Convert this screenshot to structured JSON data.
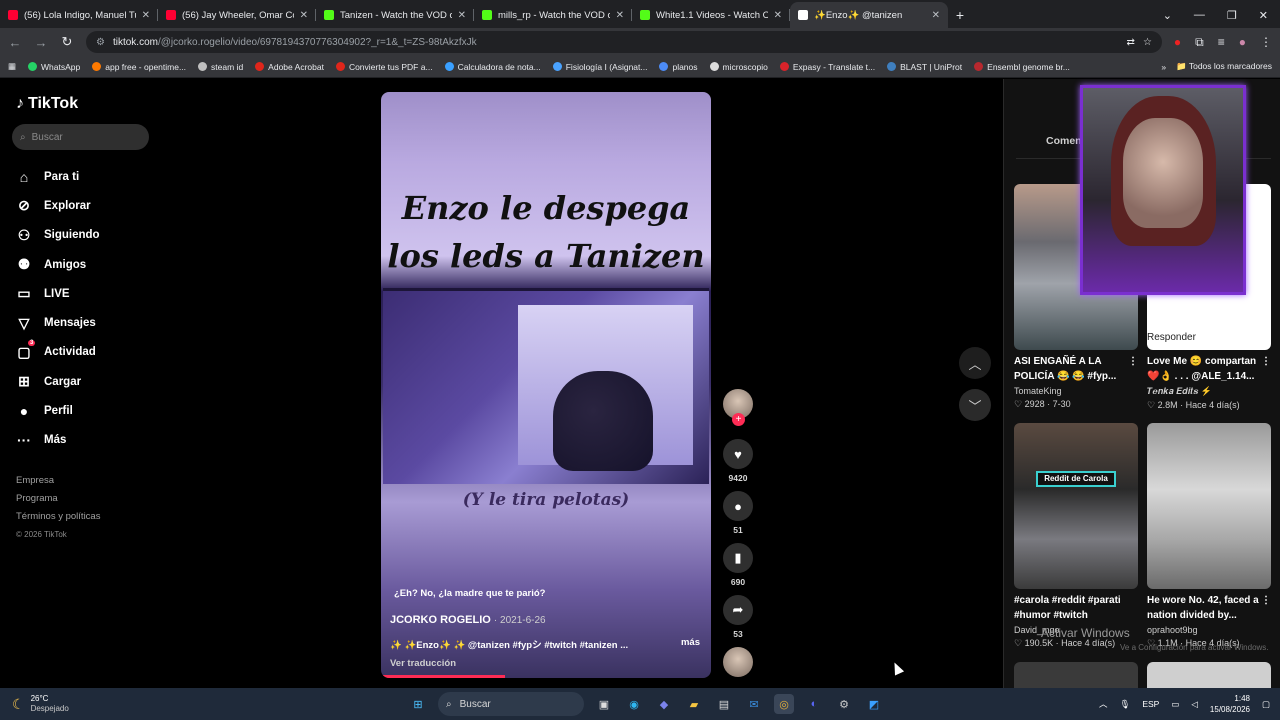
{
  "browser": {
    "tabs": [
      {
        "title": "(56) Lola Indigo, Manuel Turizo",
        "color": "#ff0033",
        "active": false
      },
      {
        "title": "(56) Jay Wheeler, Omar Courtz",
        "color": "#ff0033",
        "active": false
      },
      {
        "title": "Tanizen - Watch the VOD on Ki",
        "color": "#53fc18",
        "active": false
      },
      {
        "title": "mills_rp - Watch the VOD on Ki",
        "color": "#53fc18",
        "active": false
      },
      {
        "title": "White1.1 Videos - Watch On-De",
        "color": "#53fc18",
        "active": false
      },
      {
        "title": "✨Enzo✨ @tanizen",
        "color": "#ffffff",
        "active": true
      }
    ],
    "new_tab": "+",
    "url_host": "tiktok.com",
    "url_rest": "/@jcorko.rogelio/video/6978194370776304902?_r=1&_t=ZS-98tAkzfxJk",
    "bookmarks": [
      {
        "label": "WhatsApp",
        "color": "#25d366"
      },
      {
        "label": "app free - opentime...",
        "color": "#ff7a00"
      },
      {
        "label": "steam id",
        "color": "#c0c0c0"
      },
      {
        "label": "Adobe Acrobat",
        "color": "#e0261b"
      },
      {
        "label": "Convierte tus PDF a...",
        "color": "#e0261b"
      },
      {
        "label": "Calculadora de nota...",
        "color": "#3aa0ff"
      },
      {
        "label": "Fisiología I (Asignat...",
        "color": "#4aa3ff"
      },
      {
        "label": "planos",
        "color": "#4c8bf5"
      },
      {
        "label": "microscopio",
        "color": "#dddddd"
      },
      {
        "label": "Expasy - Translate t...",
        "color": "#d8232a"
      },
      {
        "label": "BLAST | UniProt",
        "color": "#3f7fbf"
      },
      {
        "label": "Ensembl genome br...",
        "color": "#b8282e"
      }
    ],
    "bookmarks_more": "»",
    "all_bookmarks": "Todos los marcadores"
  },
  "sidebar": {
    "logo": "TikTok",
    "search_placeholder": "Buscar",
    "items": [
      {
        "label": "Para ti",
        "icon": "home-icon",
        "glyph": "⌂"
      },
      {
        "label": "Explorar",
        "icon": "compass-icon",
        "glyph": "⊘"
      },
      {
        "label": "Siguiendo",
        "icon": "following-icon",
        "glyph": "⚇"
      },
      {
        "label": "Amigos",
        "icon": "friends-icon",
        "glyph": "⚉"
      },
      {
        "label": "LIVE",
        "icon": "live-icon",
        "glyph": "▭"
      },
      {
        "label": "Mensajes",
        "icon": "messages-icon",
        "glyph": "▽"
      },
      {
        "label": "Actividad",
        "icon": "activity-icon",
        "glyph": "▢",
        "badge": "3"
      },
      {
        "label": "Cargar",
        "icon": "upload-icon",
        "glyph": "⊞"
      },
      {
        "label": "Perfil",
        "icon": "profile-icon",
        "glyph": "●"
      },
      {
        "label": "Más",
        "icon": "more-icon",
        "glyph": "···"
      }
    ],
    "footer": [
      "Empresa",
      "Programa",
      "Términos y políticas"
    ],
    "copyright": "© 2026 TikTok"
  },
  "video": {
    "title_line1": "Enzo le despega",
    "title_line2": "los leds a Tanizen",
    "subtitle": "(Y le tira pelotas)",
    "caption": "¿Eh? No, ¿la madre que te parió?",
    "author": "JCORKO ROGELIO",
    "date": "· 2021-6-26",
    "description": "✨ ✨Enzo✨ ✨ @tanizen #fypシ #twitch #tanizen ...",
    "more": "más",
    "translate": "Ver traducción",
    "progress": 0.37
  },
  "actions": {
    "likes": "9420",
    "comments": "51",
    "saves": "690",
    "shares": "53"
  },
  "right_panel": {
    "tab": "Comen",
    "cards": [
      {
        "title": "ASI ENGAÑÉ A LA POLICÍA 😂 😂 #fyp...",
        "user": "TomateKing",
        "stats": "♡ 2928 · 7-30"
      },
      {
        "title": "Love Me 😊 compartan ❤️👌 . . . @ALE_1.14...",
        "user": "𝑻𝒆𝒏𝒌𝒂 𝑬𝒅𝒊𝒕𝒔 ⚡",
        "stats": "♡ 2.8M · Hace 4 día(s)",
        "overlay": "Responder"
      },
      {
        "title": "#carola #reddit #parati #humor #twitch",
        "user": "David_mgo",
        "stats": "♡ 190.5K · Hace 4 día(s)",
        "overlay": "Reddit de Carola"
      },
      {
        "title": "He wore No. 42, faced a nation divided by...",
        "user": "oprahoot9bg",
        "stats": "♡ 1.1M · Hace 4 día(s)"
      }
    ],
    "activate_windows": "Activar Windows",
    "activate_sub": "Ve a Configuración para activar Windows."
  },
  "taskbar": {
    "temperature": "26°C",
    "weather": "Despejado",
    "search": "Buscar",
    "language": "ESP",
    "time": "1:48",
    "date": "15/08/2026"
  }
}
